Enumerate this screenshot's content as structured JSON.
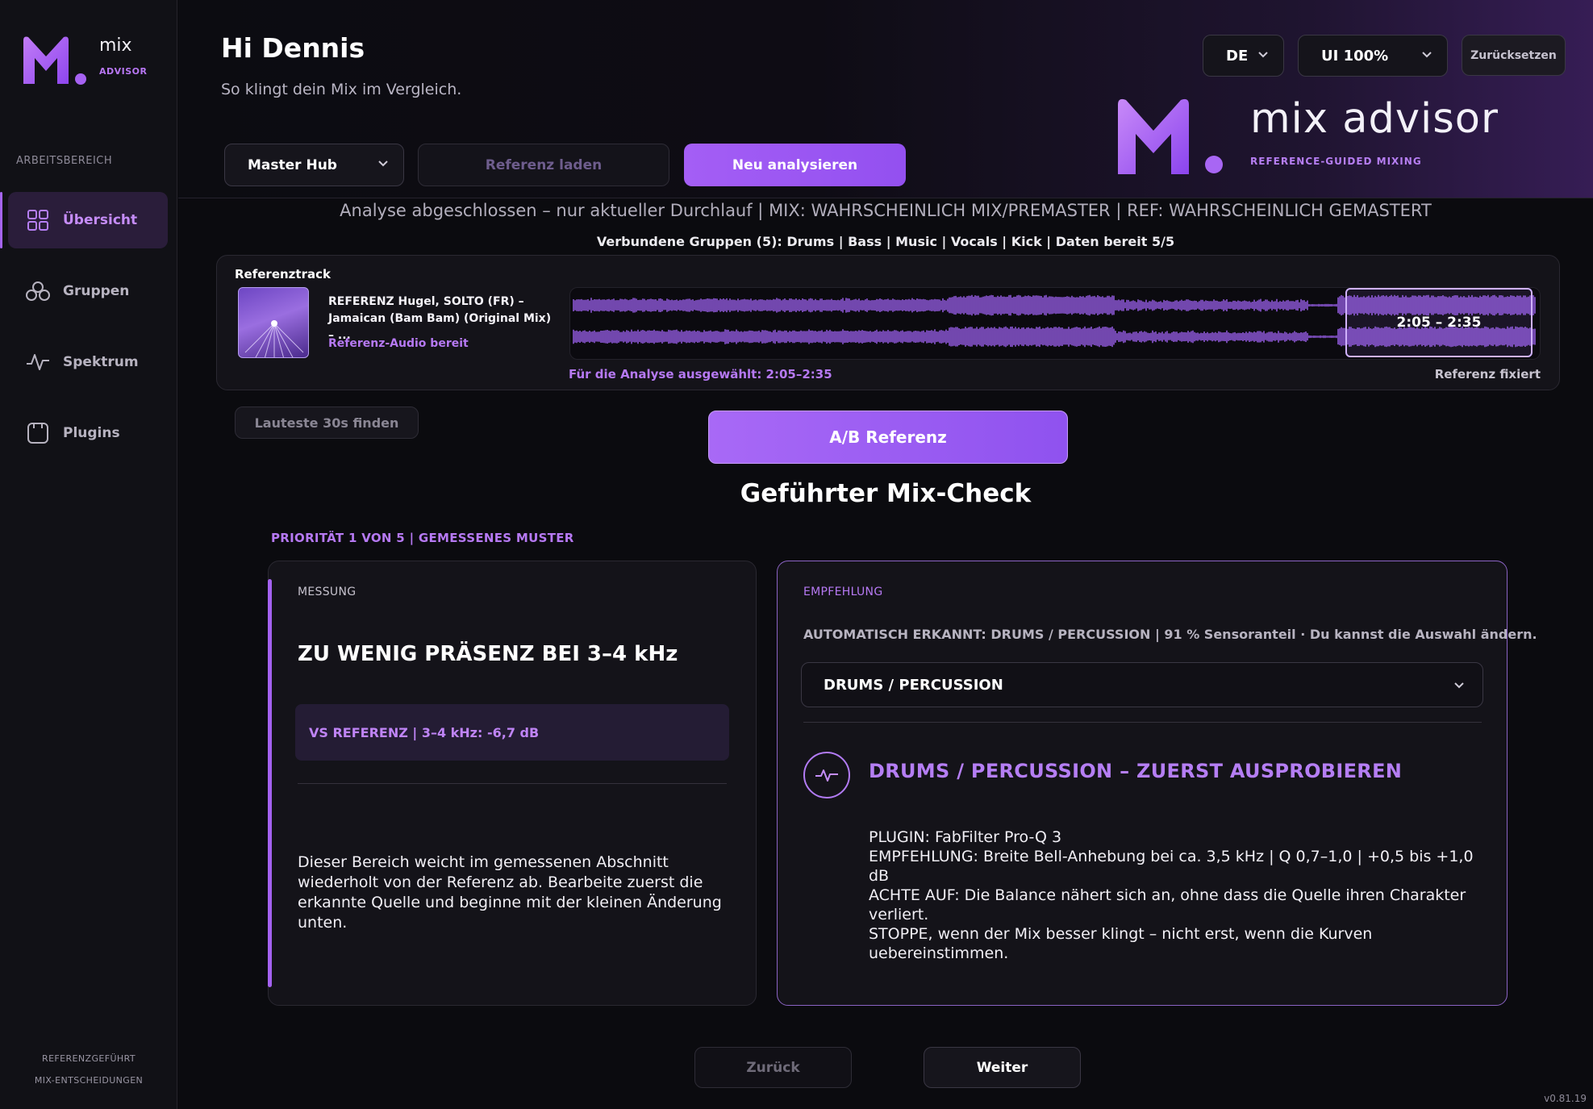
{
  "sidebar": {
    "logo_word": "mix",
    "logo_sub": "ADVISOR",
    "section_label": "ARBEITSBEREICH",
    "items": [
      {
        "label": "Übersicht",
        "icon": "grid-icon",
        "active": true
      },
      {
        "label": "Gruppen",
        "icon": "circles-icon",
        "active": false
      },
      {
        "label": "Spektrum",
        "icon": "waveform-icon",
        "active": false
      },
      {
        "label": "Plugins",
        "icon": "plugin-icon",
        "active": false
      }
    ],
    "footer_line1": "REFERENZGEFÜHRT",
    "footer_line2": "MIX-ENTSCHEIDUNGEN"
  },
  "header": {
    "greeting": "Hi Dennis",
    "subtitle": "So klingt dein Mix im Vergleich.",
    "language": "DE",
    "ui_scale": "UI 100%",
    "reset_label": "Zurücksetzen",
    "brand_title": "mix advisor",
    "brand_sub": "REFERENCE-GUIDED MIXING"
  },
  "toolbar": {
    "master_hub": "Master Hub",
    "load_reference": "Referenz laden",
    "reanalyze": "Neu analysieren"
  },
  "status": {
    "line": "Analyse abgeschlossen – nur aktueller Durchlauf | MIX: WAHRSCHEINLICH MIX/PREMASTER | REF: WAHRSCHEINLICH GEMASTERT",
    "groups": "Verbundene Gruppen (5): Drums  |  Bass  |  Music  |  Vocals  |  Kick | Daten bereit 5/5"
  },
  "reference": {
    "label": "Referenztrack",
    "title": "REFERENZ Hugel, SOLTO (FR) – Jamaican (Bam Bam) (Original Mix) – ...",
    "ready": "Referenz-Audio bereit",
    "selection": "2:05 – 2:35",
    "selected_for_analysis": "Für die Analyse ausgewählt: 2:05–2:35",
    "fixed": "Referenz fixiert",
    "selection_start_fraction": 0.808,
    "selection_end_fraction": 1.0
  },
  "actions": {
    "loudest": "Lauteste 30s finden",
    "ab": "A/B Referenz"
  },
  "guided": {
    "title": "Geführter Mix-Check",
    "priority": "PRIORITÄT 1 VON 5 | GEMESSENES MUSTER"
  },
  "measurement": {
    "heading": "MESSUNG",
    "title": "ZU WENIG PRÄSENZ BEI 3–4 kHz",
    "pill": "VS REFERENZ | 3–4 kHz: -6,7 dB",
    "body": "Dieser Bereich weicht im gemessenen Abschnitt wiederholt von der Referenz ab. Bearbeite zuerst die erkannte Quelle und beginne mit der kleinen Änderung unten."
  },
  "recommendation": {
    "heading": "EMPFEHLUNG",
    "auto": "AUTOMATISCH ERKANNT: DRUMS / PERCUSSION | 91 % Sensoranteil · Du kannst die Auswahl ändern.",
    "select_value": "DRUMS / PERCUSSION",
    "title": "DRUMS / PERCUSSION – ZUERST AUSPROBIEREN",
    "plugin": "PLUGIN: FabFilter Pro-Q 3",
    "empfehlung": "EMPFEHLUNG: Breite Bell-Anhebung bei ca. 3,5 kHz | Q 0,7–1,0 | +0,5 bis +1,0 dB",
    "achte": "ACHTE AUF: Die Balance nähert sich an, ohne dass die Quelle ihren Charakter verliert.",
    "stoppe": "STOPPE, wenn der Mix besser klingt – nicht erst, wenn die Kurven uebereinstimmen."
  },
  "nav": {
    "back": "Zurück",
    "next": "Weiter"
  },
  "version": "v0.81.19",
  "colors": {
    "accent": "#a462f0",
    "accent_light": "#b679f3",
    "background": "#0b0b0f"
  }
}
